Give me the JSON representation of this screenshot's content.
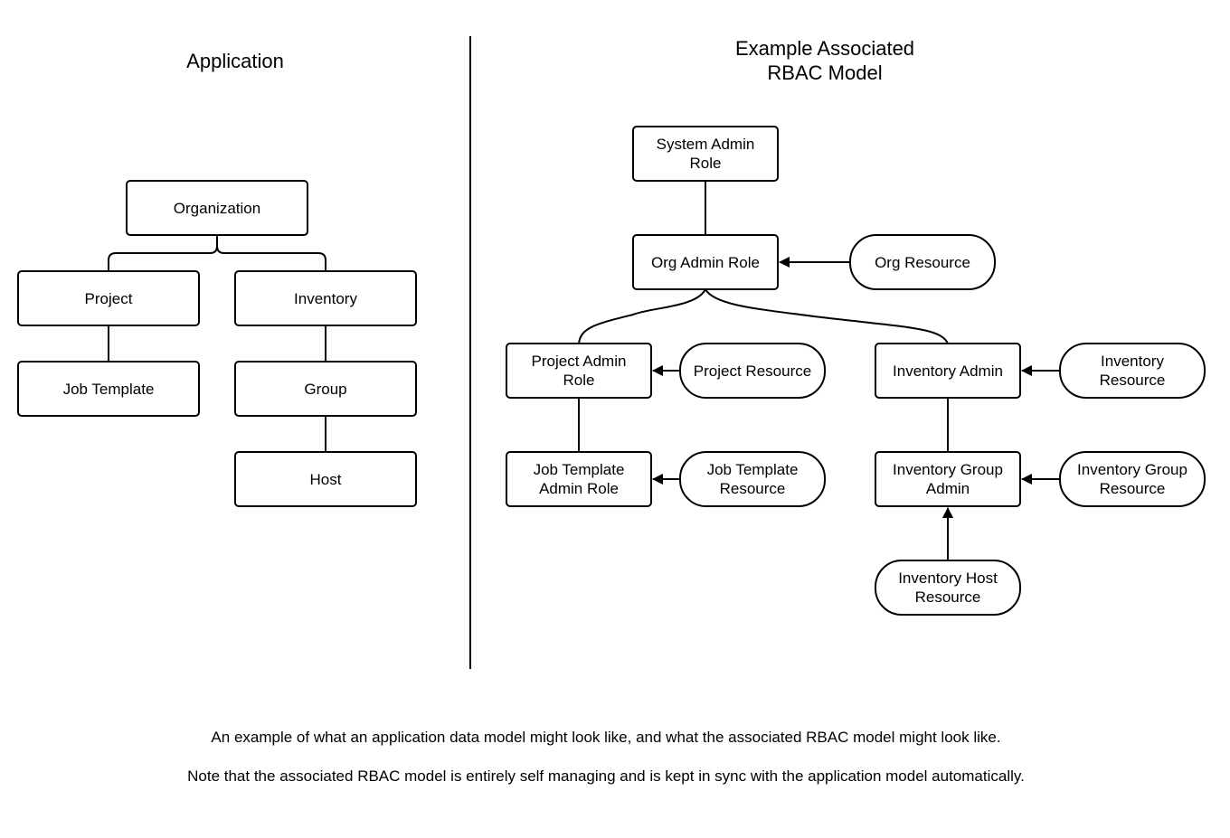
{
  "application": {
    "title": "Application",
    "nodes": {
      "organization": "Organization",
      "project": "Project",
      "inventory": "Inventory",
      "job_template": "Job Template",
      "group": "Group",
      "host": "Host"
    }
  },
  "rbac": {
    "title": "Example Associated\nRBAC Model",
    "roles": {
      "system_admin": "System Admin\nRole",
      "org_admin": "Org Admin Role",
      "project_admin": "Project Admin\nRole",
      "inventory_admin": "Inventory Admin",
      "job_template_admin": "Job Template\nAdmin Role",
      "inventory_group_admin": "Inventory Group\nAdmin"
    },
    "resources": {
      "org": "Org Resource",
      "project": "Project Resource",
      "inventory": "Inventory\nResource",
      "job_template": "Job Template\nResource",
      "inventory_group": "Inventory Group\nResource",
      "inventory_host": "Inventory Host\nResource"
    }
  },
  "captions": [
    "An example of what an application data model might look like, and what the associated RBAC model might look like.",
    "Note that the associated RBAC model is entirely self managing and is kept in sync with the application model automatically."
  ]
}
